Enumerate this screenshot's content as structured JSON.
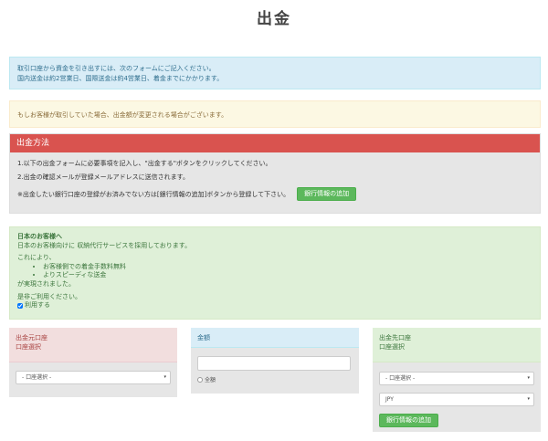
{
  "page": {
    "title": "出金"
  },
  "info": {
    "line1": "取引口座から資金を引き出すには、次のフォームにご記入ください。",
    "line2": "国内送金は約2営業日、国際送金は約4営業日、着金までにかかります。"
  },
  "warning": {
    "text": "もしお客様が取引していた場合、出金額が変更される場合がございます。"
  },
  "method": {
    "heading": "出金方法",
    "step1": "1.以下の出金フォームに必要事項を記入し、\"出金する\"ボタンをクリックしてください。",
    "step2": "2.出金の確認メールが登録メールアドレスに送信されます。",
    "note": "※出金したい銀行口座の登録がお済みでない方は[銀行情報の追加]ボタンから登録して下さい。",
    "add_bank_label": "銀行情報の追加"
  },
  "japan": {
    "heading": "日本のお客様へ",
    "intro": "日本のお客様向けに 収納代行サービスを採用しております。",
    "lead": "これにより、",
    "benefits": [
      "お客様側での着金手数料無料",
      "よりスピーディな送金"
    ],
    "realized": "が実現されました。",
    "cta": "是非ご利用ください。",
    "use_label": "利用する",
    "use_checked": true
  },
  "source": {
    "heading": "出金元口座",
    "sub": "口座選択",
    "select_value": "- 口座選択 -"
  },
  "amount": {
    "heading": "金額",
    "value": "",
    "all_label": "全額"
  },
  "dest": {
    "heading": "出金先口座",
    "sub": "口座選択",
    "select_value": "- 口座選択 -",
    "currency": "JPY",
    "add_bank_label": "銀行情報の追加"
  },
  "colors": {
    "danger": "#d9534f",
    "success": "#5cb85c",
    "info_bg": "#d9edf7",
    "warning_bg": "#fcf8e3",
    "success_bg": "#dff0d8",
    "danger_bg": "#f2dede"
  }
}
